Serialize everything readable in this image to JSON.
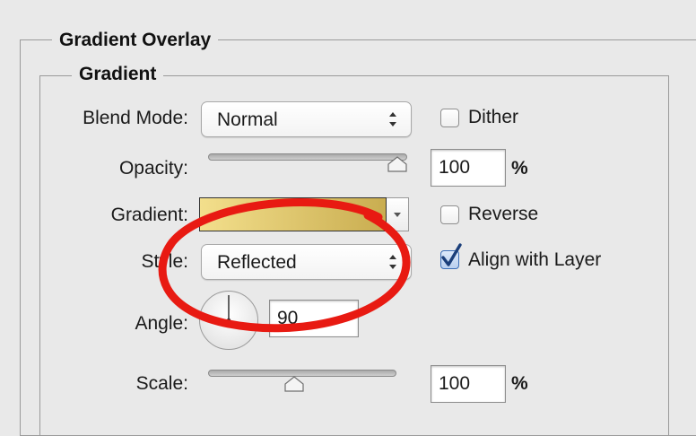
{
  "panel": {
    "outer_legend": "Gradient Overlay",
    "inner_legend": "Gradient"
  },
  "blend_mode": {
    "label": "Blend Mode:",
    "value": "Normal"
  },
  "dither": {
    "label": "Dither",
    "checked": false
  },
  "opacity": {
    "label": "Opacity:",
    "value": "100",
    "unit": "%",
    "slider_fraction": 1.0
  },
  "gradient": {
    "label": "Gradient:",
    "color_start": "#f3df8c",
    "color_end": "#c9ad50"
  },
  "reverse": {
    "label": "Reverse",
    "checked": false
  },
  "style": {
    "label": "Style:",
    "value": "Reflected"
  },
  "align_with_layer": {
    "label": "Align with Layer",
    "checked": true
  },
  "angle": {
    "label": "Angle:",
    "value": "90",
    "unit": "°",
    "degrees": 90
  },
  "scale": {
    "label": "Scale:",
    "value": "100",
    "unit": "%",
    "slider_fraction": 0.45
  },
  "colors": {
    "highlight_circle": "#e81a12",
    "checkmark": "#1b3f7a"
  },
  "icons": {
    "select_arrows": "up-down-chevrons-icon",
    "dropdown": "triangle-down-icon",
    "checkmark": "checkmark-icon"
  }
}
